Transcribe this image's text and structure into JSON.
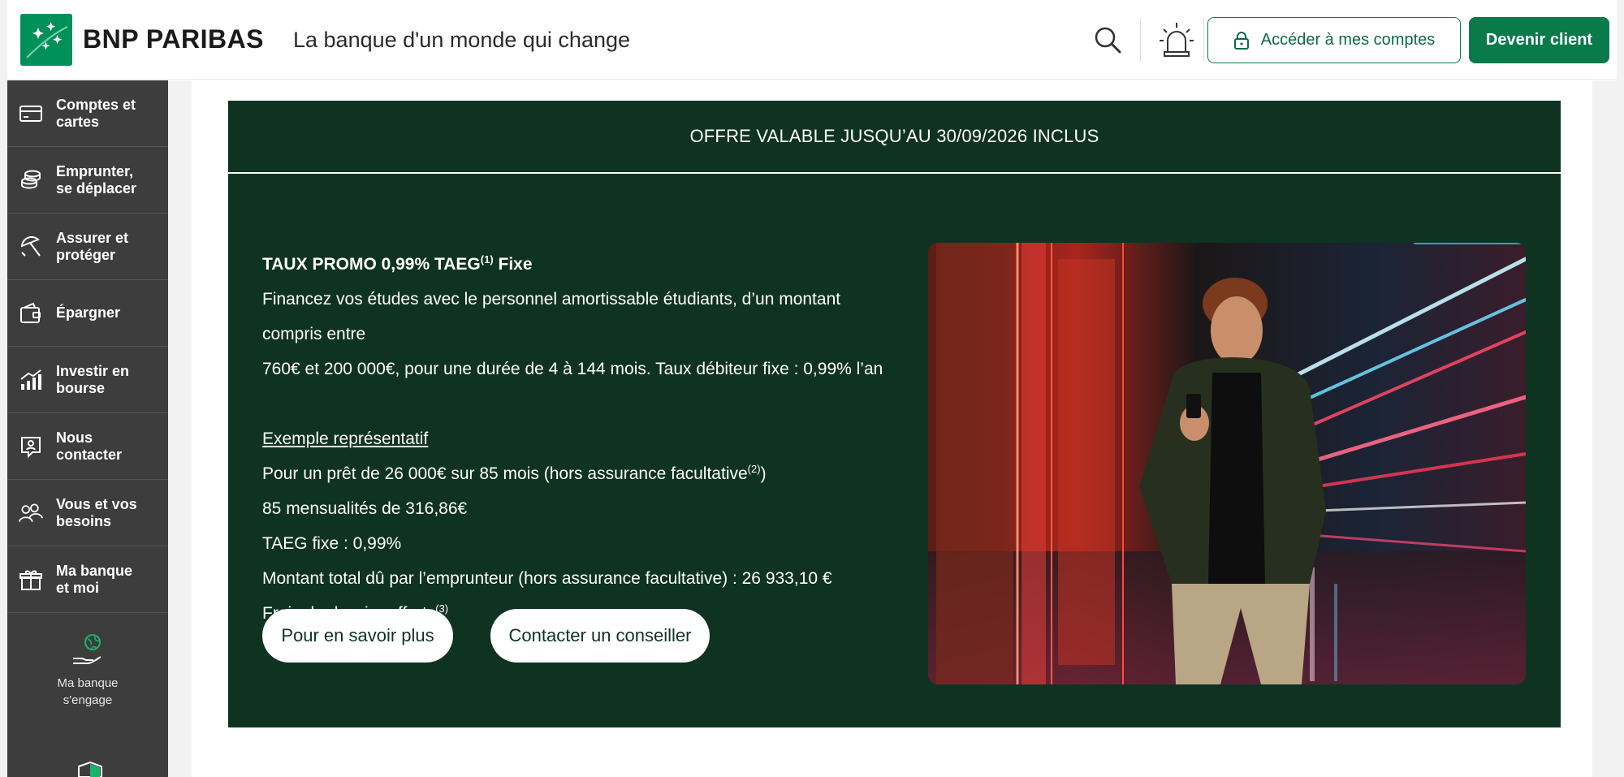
{
  "header": {
    "brand": "BNP PARIBAS",
    "tagline": "La banque d'un monde qui change",
    "access_label": "Accéder à mes comptes",
    "client_label": "Devenir client",
    "icons": [
      "logo-stars-icon",
      "search-icon",
      "alert-beacon-icon",
      "lock-icon"
    ]
  },
  "sidebar": {
    "items": [
      {
        "label": "Comptes et cartes",
        "line1": "Comptes et",
        "line2": "cartes",
        "icon": "card-icon"
      },
      {
        "label": "Emprunter, se déplacer",
        "line1": "Emprunter,",
        "line2": "se déplacer",
        "icon": "coins-icon"
      },
      {
        "label": "Assurer et protéger",
        "line1": "Assurer et",
        "line2": "protéger",
        "icon": "umbrella-icon"
      },
      {
        "label": "Épargner",
        "line1": "Épargner",
        "line2": "",
        "icon": "wallet-icon"
      },
      {
        "label": "Investir en bourse",
        "line1": "Investir en",
        "line2": "bourse",
        "icon": "chart-icon"
      },
      {
        "label": "Nous contacter",
        "line1": "Nous",
        "line2": "contacter",
        "icon": "contact-icon"
      },
      {
        "label": "Vous et vos besoins",
        "line1": "Vous et vos",
        "line2": "besoins",
        "icon": "people-icon"
      },
      {
        "label": "Ma banque et moi",
        "line1": "Ma banque",
        "line2": "et moi",
        "icon": "gift-icon"
      }
    ],
    "engage_line1": "Ma banque",
    "engage_line2": "s'engage"
  },
  "promo": {
    "offer_validity": "OFFRE VALABLE JUSQU’AU 30/09/2026 INCLUS",
    "title": "TAUX PROMO 0,99% TAEG",
    "title_sup": "(1)",
    "title_suffix": " Fixe",
    "desc_line1": "Financez vos études avec le personnel amortissable étudiants, d’un montant compris entre",
    "desc_line2": "760€ et 200 000€, pour une durée de 4 à 144 mois. Taux débiteur fixe : 0,99% l’an",
    "example_heading": "Exemple représentatif",
    "example_line1": "Pour un prêt de 26 000€ sur 85 mois (hors assurance facultative",
    "example_line1_sup": "(2)",
    "example_line1_end": ")",
    "example_line2": "85 mensualités de 316,86€",
    "example_line3": "TAEG fixe : 0,99%",
    "example_line4": "Montant total dû par l’emprunteur (hors assurance facultative) : 26 933,10 €",
    "example_line5": "Frais de dossier offerts",
    "example_line5_sup": "(3)",
    "more_label": "Pour en savoir plus",
    "advisor_label": "Contacter un conseiller"
  },
  "colors": {
    "brand_green": "#0b7a4b",
    "promo_bg": "#0f3322",
    "sidebar_bg": "#3d3d3d"
  }
}
